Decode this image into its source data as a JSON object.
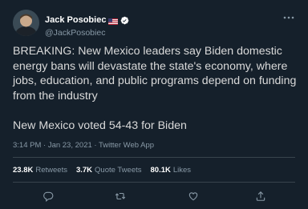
{
  "author": {
    "display_name": "Jack Posobiec",
    "handle": "@JackPosobiec",
    "icons": [
      "us-flag-icon",
      "verified-badge-icon"
    ]
  },
  "tweet": {
    "text": "BREAKING: New Mexico leaders say Biden domestic energy bans will devastate the state's economy, where jobs, education, and public programs depend on funding from the industry\n\nNew Mexico voted 54-43 for Biden",
    "time": "3:14 PM · Jan 23, 2021 · Twitter Web App"
  },
  "stats": {
    "retweets_count": "23.8K",
    "retweets_label": "Retweets",
    "quotes_count": "3.7K",
    "quotes_label": "Quote Tweets",
    "likes_count": "80.1K",
    "likes_label": "Likes"
  },
  "actions": [
    "reply-icon",
    "retweet-icon",
    "like-icon",
    "share-icon"
  ],
  "colors": {
    "background": "#15202b",
    "text": "#d9d9d9",
    "secondary": "#8899a6",
    "divider": "#38444d",
    "verified": "#ffffff"
  }
}
